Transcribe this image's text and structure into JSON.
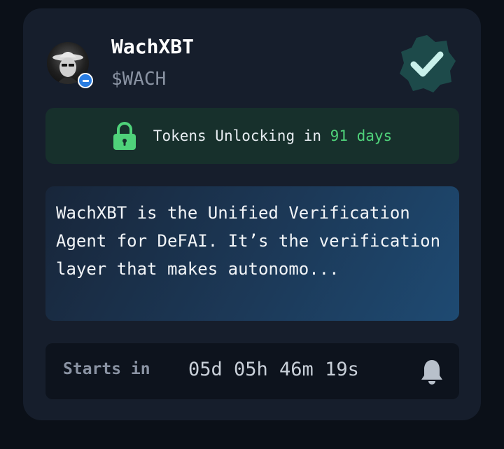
{
  "token": {
    "name": "WachXBT",
    "ticker": "$WACH"
  },
  "unlock": {
    "prefix": "Tokens Unlocking in",
    "days": "91 days"
  },
  "description": "WachXBT is the Unified Verification Agent for DeFAI. It’s the verification layer that makes autonomo...",
  "countdown": {
    "label": "Starts in",
    "time": "05d 05h 46m 19s"
  },
  "icons": {
    "verified": "verified-badge-icon",
    "lock": "lock-icon",
    "bell": "bell-icon",
    "chain": "chain-badge-icon"
  },
  "colors": {
    "card_bg": "#161e2c",
    "unlock_bg": "#17302c",
    "accent_green": "#4fd27a",
    "verified_badge": "#1d4a4a",
    "verified_check": "#c8f0ea"
  }
}
